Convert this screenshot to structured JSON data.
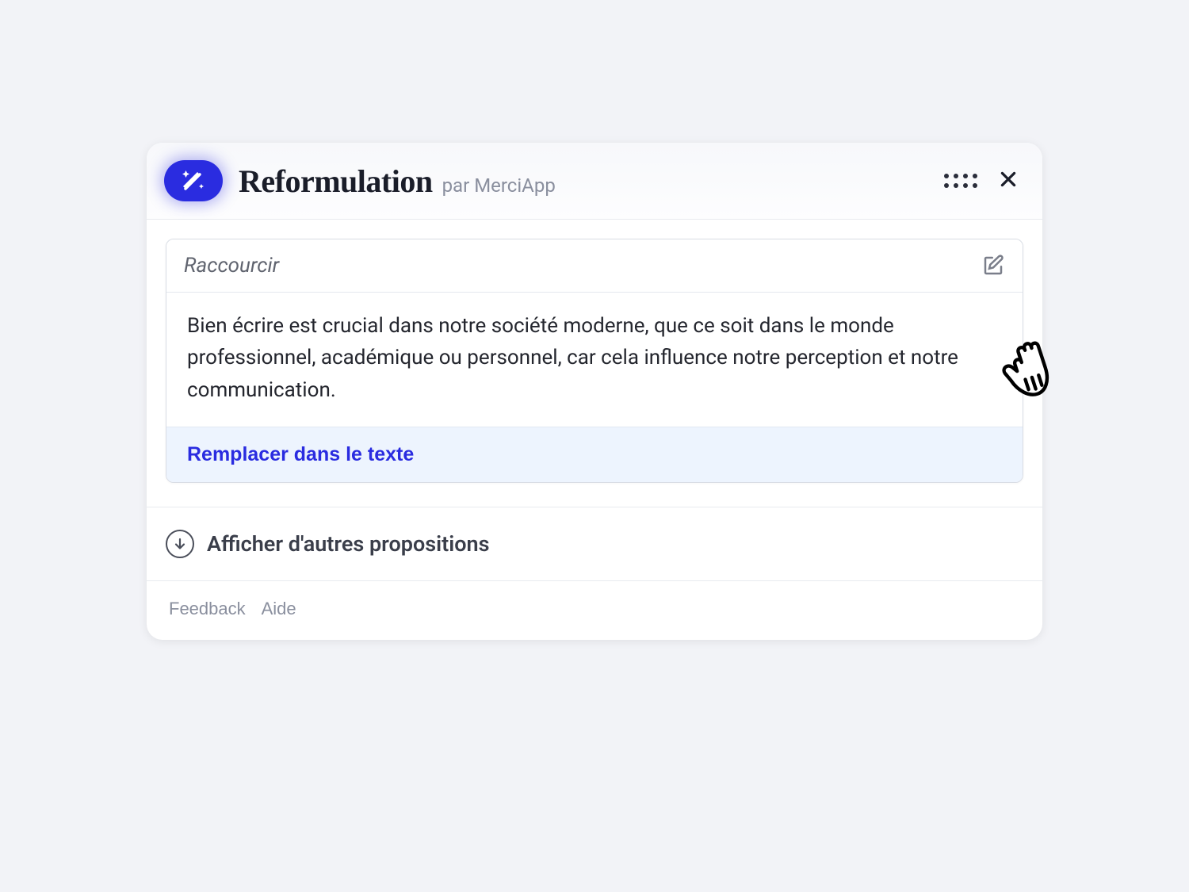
{
  "header": {
    "title": "Reformulation",
    "subtitle": "par MerciApp"
  },
  "panel": {
    "mode": "Raccourcir",
    "body": "Bien écrire est crucial dans notre société moderne, que ce soit dans le monde professionnel, académique ou personnel, car cela influence notre perception et notre communication.",
    "replace_label": "Remplacer dans le texte"
  },
  "more": {
    "label": "Afficher d'autres propositions"
  },
  "footer": {
    "feedback": "Feedback",
    "help": "Aide"
  }
}
